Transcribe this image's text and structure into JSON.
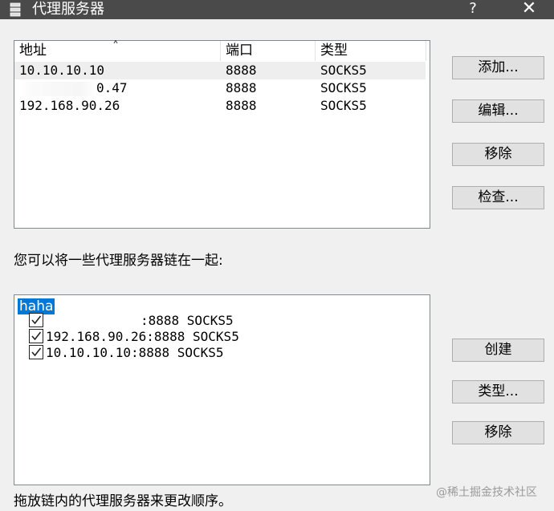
{
  "window": {
    "title": "代理服务器",
    "help_label": "?",
    "close_label": "✕",
    "icon": "server-icon"
  },
  "proxy_list": {
    "columns": {
      "address": "地址",
      "port": "端口",
      "type": "类型"
    },
    "sort_indicator": "˄",
    "rows": [
      {
        "address": "10.10.10.10",
        "port": "8888",
        "type": "SOCKS5"
      },
      {
        "address_suffix": "0.47",
        "port": "8888",
        "type": "SOCKS5"
      },
      {
        "address": "192.168.90.26",
        "port": "8888",
        "type": "SOCKS5"
      }
    ]
  },
  "proxy_buttons": {
    "add": "添加...",
    "edit": "编辑...",
    "remove": "移除",
    "check": "检查..."
  },
  "chain_label": "您可以将一些代理服务器链在一起:",
  "chain": {
    "name": "haha",
    "items": [
      {
        "text": ":8888 SOCKS5",
        "checked": true
      },
      {
        "text": "192.168.90.26:8888 SOCKS5",
        "checked": true
      },
      {
        "text": "10.10.10.10:8888 SOCKS5",
        "checked": true
      }
    ]
  },
  "chain_buttons": {
    "create": "创建",
    "type": "类型...",
    "remove": "移除"
  },
  "footer": "拖放链内的代理服务器来更改顺序。",
  "watermark": "@稀土掘金技术社区"
}
